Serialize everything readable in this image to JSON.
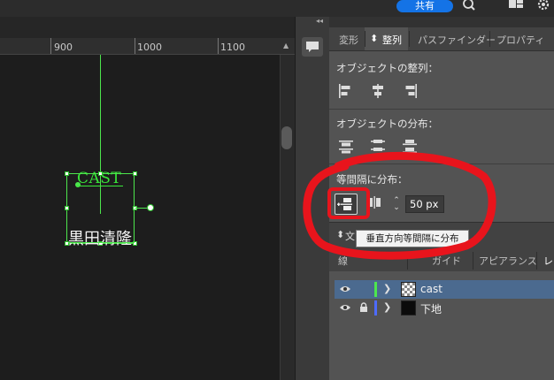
{
  "topbar": {
    "share_label": "共有",
    "icons": [
      "search-icon",
      "arrange-icon",
      "settings-icon"
    ]
  },
  "ruler": {
    "ticks": [
      "900",
      "1000",
      "1100"
    ]
  },
  "canvas": {
    "text_cast": "CAST",
    "text_name": "黒田清隆"
  },
  "panel": {
    "tabs": [
      {
        "label": "変形"
      },
      {
        "label": "整列"
      },
      {
        "label": "パスファインダー"
      },
      {
        "label": "プロパティ"
      }
    ],
    "align_objects_title": "オブジェクトの整列：",
    "distribute_objects_title": "オブジェクトの分布：",
    "distribute_spacing_title": "等間隔に分布：",
    "spacing_value": "50 px",
    "tooltip": "垂直方向等間隔に分布",
    "collapsed_panel_label": "文"
  },
  "bottom_panel": {
    "tabs": [
      {
        "label": "線"
      },
      {
        "label": "ガイド"
      },
      {
        "label": "アピアランス"
      },
      {
        "label": "レ"
      }
    ]
  },
  "layers": [
    {
      "name": "cast",
      "color": "#4de64d",
      "selected": true,
      "locked": false
    },
    {
      "name": "下地",
      "color": "#4d6bff",
      "selected": false,
      "locked": true
    }
  ],
  "colors": {
    "accent": "#1473e6",
    "selection": "#4de64d",
    "annotation": "#e8141c"
  }
}
